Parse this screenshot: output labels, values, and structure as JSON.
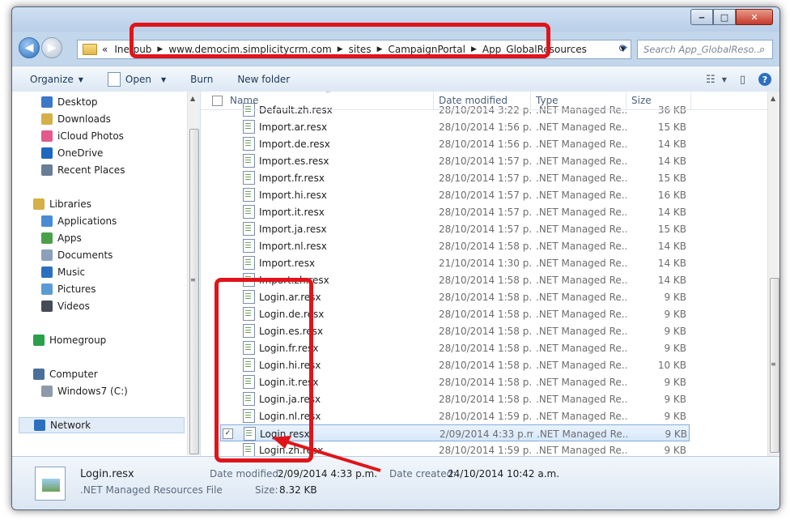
{
  "address": {
    "back_label": "◀",
    "forward_label": "▶",
    "crumbs": [
      "«",
      "Inetpub",
      "www.democim.simplicitycrm.com",
      "sites",
      "CampaignPortal",
      "App_GlobalResources"
    ],
    "search_placeholder": "Search App_GlobalReso..."
  },
  "toolbar": {
    "organize": "Organize",
    "open": "Open",
    "burn": "Burn",
    "new_folder": "New folder"
  },
  "window_buttons": {
    "minimize": "‒",
    "maximize": "□",
    "close": "✕"
  },
  "sidebar": {
    "items": [
      {
        "label": "Desktop",
        "icon": "desktop-icon",
        "color": "#3b78c8"
      },
      {
        "label": "Downloads",
        "icon": "downloads-icon",
        "color": "#d5b048"
      },
      {
        "label": "iCloud Photos",
        "icon": "icloud-photos-icon",
        "color": "#e35a8c"
      },
      {
        "label": "OneDrive",
        "icon": "onedrive-icon",
        "color": "#1f66c0"
      },
      {
        "label": "Recent Places",
        "icon": "recent-places-icon",
        "color": "#6a7d96"
      },
      {
        "label": "Libraries",
        "icon": "libraries-icon",
        "color": "#d5b048"
      },
      {
        "label": "Applications",
        "icon": "applications-icon",
        "color": "#4a8bd6"
      },
      {
        "label": "Apps",
        "icon": "apps-icon",
        "color": "#4aa04a"
      },
      {
        "label": "Documents",
        "icon": "documents-icon",
        "color": "#8aa0bc"
      },
      {
        "label": "Music",
        "icon": "music-icon",
        "color": "#2d6fbf"
      },
      {
        "label": "Pictures",
        "icon": "pictures-icon",
        "color": "#5b9bd5"
      },
      {
        "label": "Videos",
        "icon": "videos-icon",
        "color": "#444c58"
      },
      {
        "label": "Homegroup",
        "icon": "homegroup-icon",
        "color": "#2aa04a"
      },
      {
        "label": "Computer",
        "icon": "computer-icon",
        "color": "#4a6f9c"
      },
      {
        "label": "Windows7 (C:)",
        "icon": "drive-icon",
        "color": "#8c9aab"
      },
      {
        "label": "Network",
        "icon": "network-icon",
        "color": "#2d6fbf"
      }
    ]
  },
  "columns": {
    "name": "Name",
    "date": "Date modified",
    "type": "Type",
    "size": "Size"
  },
  "files": [
    {
      "name": "Default.zh.resx",
      "date": "28/10/2014 3:22 p....",
      "type": ".NET Managed Re...",
      "size": "36 KB"
    },
    {
      "name": "Import.ar.resx",
      "date": "28/10/2014 1:56 p....",
      "type": ".NET Managed Re...",
      "size": "15 KB"
    },
    {
      "name": "Import.de.resx",
      "date": "28/10/2014 1:56 p....",
      "type": ".NET Managed Re...",
      "size": "14 KB"
    },
    {
      "name": "Import.es.resx",
      "date": "28/10/2014 1:57 p....",
      "type": ".NET Managed Re...",
      "size": "14 KB"
    },
    {
      "name": "Import.fr.resx",
      "date": "28/10/2014 1:57 p....",
      "type": ".NET Managed Re...",
      "size": "15 KB"
    },
    {
      "name": "Import.hi.resx",
      "date": "28/10/2014 1:57 p....",
      "type": ".NET Managed Re...",
      "size": "16 KB"
    },
    {
      "name": "Import.it.resx",
      "date": "28/10/2014 1:57 p....",
      "type": ".NET Managed Re...",
      "size": "14 KB"
    },
    {
      "name": "Import.ja.resx",
      "date": "28/10/2014 1:57 p....",
      "type": ".NET Managed Re...",
      "size": "15 KB"
    },
    {
      "name": "Import.nl.resx",
      "date": "28/10/2014 1:58 p....",
      "type": ".NET Managed Re...",
      "size": "14 KB"
    },
    {
      "name": "Import.resx",
      "date": "21/10/2014 1:30 p....",
      "type": ".NET Managed Re...",
      "size": "14 KB"
    },
    {
      "name": "Import.zh.resx",
      "date": "28/10/2014 1:58 p....",
      "type": ".NET Managed Re...",
      "size": "14 KB"
    },
    {
      "name": "Login.ar.resx",
      "date": "28/10/2014 1:58 p....",
      "type": ".NET Managed Re...",
      "size": "9 KB"
    },
    {
      "name": "Login.de.resx",
      "date": "28/10/2014 1:58 p....",
      "type": ".NET Managed Re...",
      "size": "9 KB"
    },
    {
      "name": "Login.es.resx",
      "date": "28/10/2014 1:58 p....",
      "type": ".NET Managed Re...",
      "size": "9 KB"
    },
    {
      "name": "Login.fr.resx",
      "date": "28/10/2014 1:58 p....",
      "type": ".NET Managed Re...",
      "size": "9 KB"
    },
    {
      "name": "Login.hi.resx",
      "date": "28/10/2014 1:58 p....",
      "type": ".NET Managed Re...",
      "size": "10 KB"
    },
    {
      "name": "Login.it.resx",
      "date": "28/10/2014 1:58 p....",
      "type": ".NET Managed Re...",
      "size": "9 KB"
    },
    {
      "name": "Login.ja.resx",
      "date": "28/10/2014 1:58 p....",
      "type": ".NET Managed Re...",
      "size": "9 KB"
    },
    {
      "name": "Login.nl.resx",
      "date": "28/10/2014 1:59 p....",
      "type": ".NET Managed Re...",
      "size": "9 KB"
    },
    {
      "name": "Login.resx",
      "date": "2/09/2014 4:33 p.m.",
      "type": ".NET Managed Re...",
      "size": "9 KB",
      "selected": true
    },
    {
      "name": "Login.zh.resx",
      "date": "28/10/2014 1:59 p....",
      "type": ".NET Managed Re...",
      "size": "9 KB"
    }
  ],
  "status": {
    "name": "Login.resx",
    "type": ".NET Managed Resources File",
    "date_modified_label": "Date modified:",
    "date_modified": "2/09/2014 4:33 p.m.",
    "date_created_label": "Date created:",
    "date_created": "24/10/2014 10:42 a.m.",
    "size_label": "Size:",
    "size": "8.32 KB"
  },
  "colors": {
    "annotation_red": "#e0141a",
    "selection": "#d6e8fb"
  }
}
